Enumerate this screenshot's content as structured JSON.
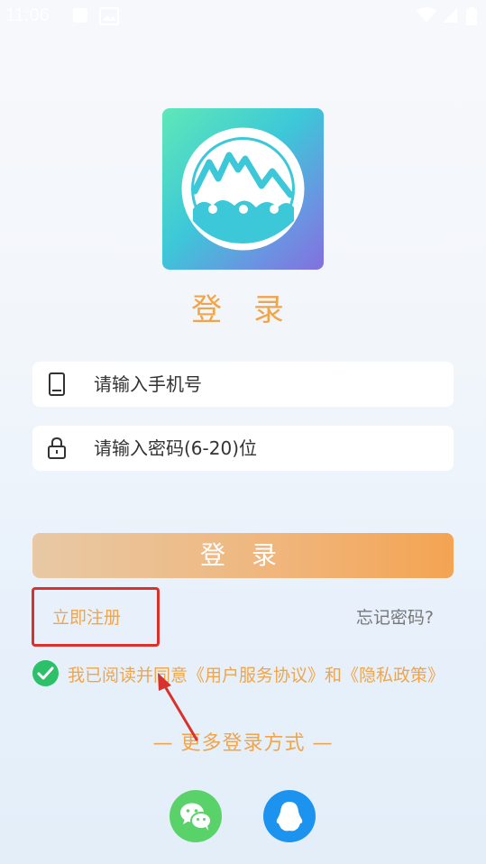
{
  "status_bar": {
    "time": "11:06"
  },
  "title": "登 录",
  "phone_field": {
    "placeholder": "请输入手机号",
    "icon": "phone-icon"
  },
  "password_field": {
    "placeholder": "请输入密码(6-20)位",
    "icon": "lock-icon"
  },
  "login_button": "登 录",
  "register_link": "立即注册",
  "forgot_link": "忘记密码?",
  "agreement": {
    "prefix": "我已阅读并同意",
    "user_agreement": "《用户服务协议》",
    "conjunction": "和",
    "privacy_policy": "《隐私政策》",
    "checked": true
  },
  "more_login": "—  更多登录方式  —",
  "social": [
    "wechat-icon",
    "qq-icon"
  ],
  "colors": {
    "accent": "#f0a54b",
    "check": "#2cc069",
    "wechat": "#5ad26a",
    "qq": "#1d93f0",
    "annotation": "#d9312b"
  }
}
